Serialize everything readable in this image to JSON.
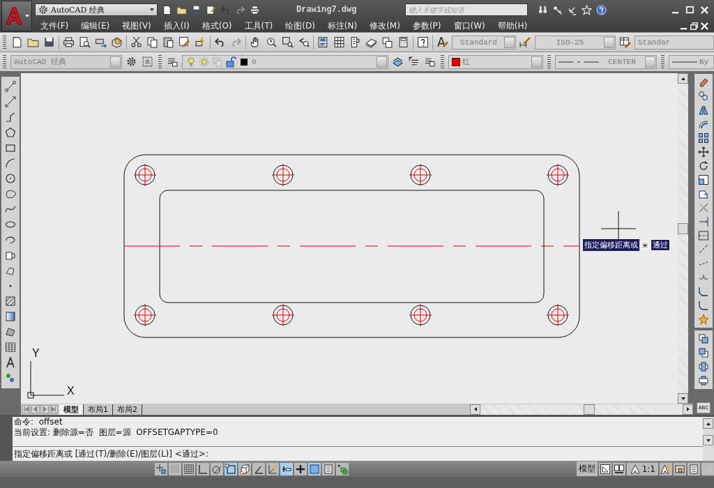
{
  "title_bar": {
    "workspace": "AutoCAD 经典",
    "title": "Drawing7.dwg",
    "search": {
      "placeholder": "键入关键字或短语"
    }
  },
  "menu_bar": [
    "文件(F)",
    "编辑(E)",
    "视图(V)",
    "插入(I)",
    "格式(O)",
    "工具(T)",
    "绘图(D)",
    "标注(N)",
    "修改(M)",
    "参数(P)",
    "窗口(W)",
    "帮助(H)"
  ],
  "styles_toolbar": {
    "text_style": "Standard",
    "dim_style": "ISO-25",
    "table_style": "Standar"
  },
  "layers_toolbar": {
    "workspace": "AutoCAD 经典",
    "layer": "0",
    "color_label": "红",
    "linetype": "CENTER",
    "lineweight": "By"
  },
  "ucs": {
    "x": "X",
    "y": "Y"
  },
  "tooltip": {
    "prompt": "指定偏移距离或",
    "option": "通过"
  },
  "layout_tabs": [
    {
      "label": "模型",
      "selected": true
    },
    {
      "label": "布局1",
      "selected": false
    },
    {
      "label": "布局2",
      "selected": false
    }
  ],
  "spell_check": "ABC",
  "command_history": [
    "命令:  offset",
    "当前设置: 删除源=否  图层=源  OFFSETGAPTYPE=0"
  ],
  "command_prompt": "指定偏移距离或 [通过(T)/删除(E)/图层(L)] <通过>:",
  "status_bar": {
    "toggles": [
      {
        "on": false
      },
      {
        "on": false
      },
      {
        "on": false
      },
      {
        "on": false
      },
      {
        "on": false
      },
      {
        "on": true
      },
      {
        "on": false
      },
      {
        "on": false
      },
      {
        "on": false
      },
      {
        "on": true
      },
      {
        "on": false
      },
      {
        "on": true
      },
      {
        "on": false
      },
      {
        "on": false
      }
    ],
    "space": "模型",
    "scale": "1:1"
  }
}
